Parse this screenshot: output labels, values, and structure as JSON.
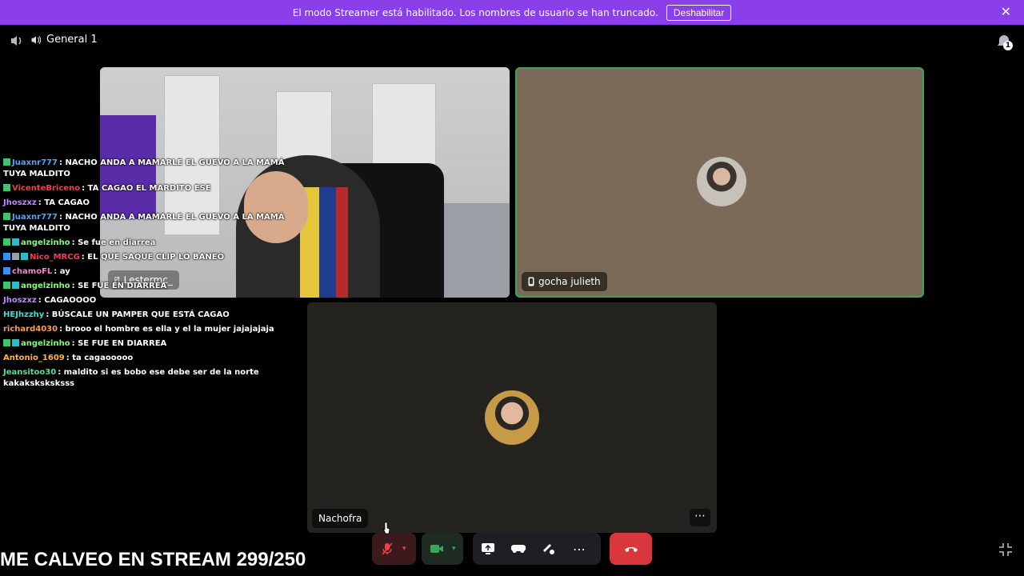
{
  "banner": {
    "message": "El modo Streamer está habilitado. Los nombres de usuario se han truncado.",
    "button": "Deshabilitar"
  },
  "header": {
    "channel_name": "General 1",
    "inbox_badge": "1"
  },
  "tiles": [
    {
      "name": "Lestermc_",
      "muted": true
    },
    {
      "name": "gocha julieth",
      "device": "mobile"
    },
    {
      "name": "Nachofra"
    }
  ],
  "chat": [
    {
      "user": "Juaxnr777",
      "user_color": "#4aa6ff",
      "text": ": NACHO ANDA A MAMARLE EL GUEVO A LA MAMÁ TUYA MALDITO",
      "badges": [
        "green"
      ]
    },
    {
      "user": "VicenteBriceno",
      "user_color": "#ff3b3b",
      "text": ": TA CAGAO EL MARDITO ESE",
      "badges": [
        "green"
      ]
    },
    {
      "user": "Jhoszxz",
      "user_color": "#b78aff",
      "text": ": TA CAGAO",
      "badges": []
    },
    {
      "user": "Juaxnr777",
      "user_color": "#4aa6ff",
      "text": ": NACHO ANDA A MAMARLE EL GUEVO A LA MAMÁ TUYA MALDITO",
      "badges": [
        "green"
      ]
    },
    {
      "user": "angelzinho",
      "user_color": "#7dff7d",
      "text": ": Se fue en diarrea",
      "badges": [
        "green",
        "teal"
      ]
    },
    {
      "user": "Nico_MRCG",
      "user_color": "#ff3355",
      "text": ": EL QUE SAQUE CLIP LO BANEO",
      "badges": [
        "blue",
        "grey",
        "teal"
      ]
    },
    {
      "user": "chamoFL",
      "user_color": "#ff7bd5",
      "text": ": ay",
      "badges": [
        "blue"
      ]
    },
    {
      "user": "angelzinho",
      "user_color": "#7dff7d",
      "text": ": SE FUE EN DIARREA",
      "badges": [
        "green",
        "teal"
      ]
    },
    {
      "user": "Jhoszxz",
      "user_color": "#b78aff",
      "text": ": CAGAOOOO",
      "badges": []
    },
    {
      "user": "HEJhzzhy",
      "user_color": "#3fe0d0",
      "text": ": BÚSCALE UN PAMPER QUE ESTÁ CAGAO",
      "badges": []
    },
    {
      "user": "richard4030",
      "user_color": "#ff9f3b",
      "text": ": brooo el hombre es ella y el la mujer jajajajaja",
      "badges": []
    },
    {
      "user": "angelzinho",
      "user_color": "#7dff7d",
      "text": ": SE FUE EN DIARREA",
      "badges": [
        "green",
        "teal"
      ]
    },
    {
      "user": "Antonio_1609",
      "user_color": "#ffb347",
      "text": ": ta cagaooooo",
      "badges": []
    },
    {
      "user": "Jeansitoo30",
      "user_color": "#4ee0a0",
      "text": ": maldito si es bobo ese debe ser de la norte kakaksksksksss",
      "badges": []
    }
  ],
  "stream_title": "ME CALVEO EN STREAM 299/250",
  "colors": {
    "banner": "#8b3fe8",
    "speaking_border": "#3ba55c",
    "hangup": "#da373c"
  },
  "icons": [
    "speaker-icon",
    "inbox-icon",
    "mic-muted-icon",
    "camera-icon",
    "screen-share-icon",
    "activity-icon",
    "soundboard-icon",
    "more-icon",
    "hangup-icon",
    "exit-fullscreen-icon",
    "mobile-icon",
    "close-icon"
  ]
}
